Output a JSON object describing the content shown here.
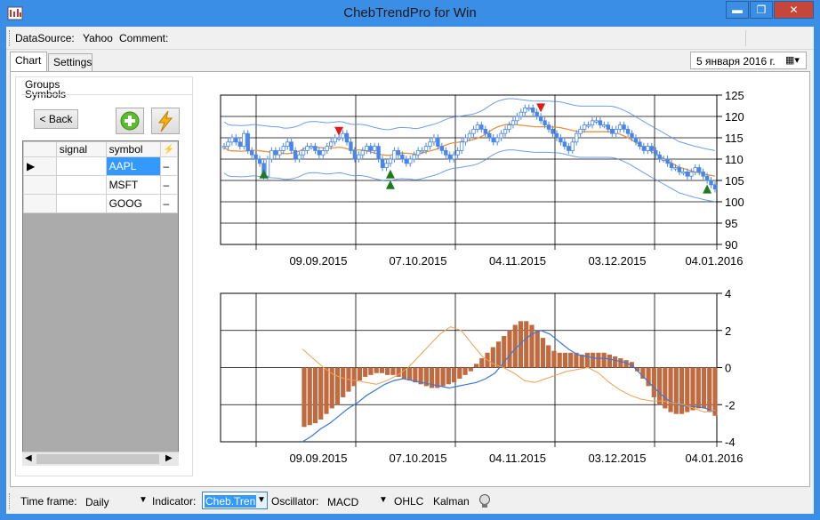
{
  "window": {
    "title": "ChebTrendPro for Win",
    "minimize": "▬",
    "maximize": "❐",
    "close": "✕"
  },
  "topbar": {
    "datasource_label": "DataSource:",
    "datasource_value": "Yahoo",
    "comment_label": "Comment:"
  },
  "tabs": [
    {
      "label": "Chart",
      "active": true
    },
    {
      "label": "Settings",
      "active": false
    }
  ],
  "date_picker": {
    "value": "5   января   2016 г."
  },
  "left": {
    "groups_label": "Groups",
    "symbols_label": "Symbols",
    "back_label": "< Back",
    "columns": [
      "signal",
      "symbol",
      "⚡"
    ],
    "rows": [
      {
        "signal": "",
        "symbol": "AAPL",
        "flag": "–",
        "selected": true
      },
      {
        "signal": "",
        "symbol": "MSFT",
        "flag": "–",
        "selected": false
      },
      {
        "signal": "",
        "symbol": "GOOG",
        "flag": "–",
        "selected": false
      }
    ]
  },
  "bottombar": {
    "timeframe_label": "Time frame:",
    "timeframe_value": "Daily",
    "indicator_label": "Indicator:",
    "indicator_value": "Cheb.Tren",
    "oscillator_label": "Oscillator:",
    "oscillator_value": "MACD",
    "ohlc_label": "OHLC",
    "kalman_label": "Kalman"
  },
  "colors": {
    "candle": "#4a86e8",
    "trend": "#e8923a",
    "channel": "#4a86e8",
    "histogram": "#c06a3f",
    "up_signal": "#1e7a1e",
    "down_signal": "#e21a1a"
  },
  "chart_data": [
    {
      "type": "candlestick",
      "x_tick_labels": [
        "09.09.2015",
        "07.10.2015",
        "04.11.2015",
        "03.12.2015",
        "04.01.2016"
      ],
      "y_tick_labels": [
        "125",
        "120",
        "115",
        "110",
        "105",
        "100",
        "95",
        "90"
      ],
      "ylim": [
        90,
        125
      ],
      "closes": [
        113,
        114,
        115,
        114,
        113,
        116,
        112,
        111,
        110,
        109,
        106,
        110,
        112,
        111,
        112,
        113,
        114,
        112,
        110,
        111,
        112,
        113,
        113,
        112,
        111,
        112,
        113,
        114,
        115,
        115,
        116,
        114,
        112,
        110,
        111,
        112,
        113,
        112,
        113,
        110,
        108,
        109,
        110,
        112,
        111,
        110,
        109,
        110,
        111,
        112,
        112,
        113,
        114,
        115,
        113,
        112,
        111,
        110,
        111,
        112,
        114,
        115,
        116,
        117,
        118,
        117,
        116,
        115,
        114,
        115,
        116,
        117,
        118,
        119,
        120,
        121,
        122,
        122,
        121,
        120,
        119,
        118,
        117,
        116,
        115,
        114,
        113,
        112,
        114,
        116,
        117,
        118,
        118,
        119,
        119,
        118,
        118,
        117,
        116,
        117,
        118,
        117,
        116,
        115,
        114,
        113,
        112,
        113,
        112,
        111,
        110,
        110,
        109,
        108,
        108,
        107,
        107,
        106,
        107,
        108,
        107,
        106,
        105,
        104,
        103
      ],
      "up_signals": [
        {
          "x": 10,
          "y": 106.5
        },
        {
          "x": 42,
          "y": 106.5
        },
        {
          "x": 42,
          "y": 104
        },
        {
          "x": 122,
          "y": 103
        }
      ],
      "down_signals": [
        {
          "x": 29,
          "y": 116.5
        },
        {
          "x": 80,
          "y": 122
        }
      ],
      "grid": true
    },
    {
      "type": "bar",
      "x_tick_labels": [
        "09.09.2015",
        "07.10.2015",
        "04.11.2015",
        "03.12.2015",
        "04.01.2016"
      ],
      "y_tick_labels": [
        "4",
        "2",
        "0",
        "-2",
        "-4"
      ],
      "ylim": [
        -4,
        4
      ],
      "histogram": [
        -3.2,
        -3.1,
        -3.0,
        -2.8,
        -2.5,
        -2.2,
        -2.0,
        -1.6,
        -1.3,
        -1.0,
        -0.7,
        -0.5,
        -0.4,
        -0.3,
        -0.3,
        -0.4,
        -0.4,
        -0.5,
        -0.6,
        -0.7,
        -0.8,
        -0.9,
        -1.0,
        -1.1,
        -1.1,
        -1.0,
        -0.9,
        -0.8,
        -0.6,
        -0.4,
        -0.2,
        0.2,
        0.5,
        0.8,
        1.1,
        1.4,
        1.7,
        2.0,
        2.3,
        2.5,
        2.5,
        2.3,
        2.0,
        1.6,
        1.2,
        0.9,
        0.8,
        0.8,
        0.8,
        0.8,
        0.7,
        0.8,
        0.8,
        0.8,
        0.8,
        0.7,
        0.6,
        0.5,
        0.4,
        0.3,
        -0.2,
        -0.6,
        -1.0,
        -1.6,
        -2.0,
        -2.2,
        -2.4,
        -2.5,
        -2.5,
        -2.4,
        -2.3,
        -2.2,
        -2.2,
        -2.4,
        -2.6
      ],
      "line_blue": [
        -4.0,
        -3.7,
        -3.3,
        -3.0,
        -2.6,
        -2.2,
        -1.9,
        -1.5,
        -1.2,
        -0.9,
        -0.7,
        -0.6,
        -0.7,
        -0.8,
        -0.9,
        -1.0,
        -1.1,
        -1.0,
        -0.9,
        -0.8,
        -0.6,
        -0.3,
        0.3,
        0.9,
        1.4,
        1.8,
        2.0,
        1.8,
        1.4,
        1.0,
        0.7,
        0.6,
        0.5,
        0.5,
        0.4,
        0.3,
        0.1,
        -0.4,
        -0.9,
        -1.4,
        -1.8,
        -2.0,
        -2.1,
        -2.1,
        -2.2,
        -2.4
      ],
      "line_orange": [
        1.0,
        0.5,
        0.0,
        -0.4,
        -0.6,
        -0.7,
        -0.8,
        -0.9,
        -0.7,
        -0.4,
        0.0,
        0.6,
        1.2,
        1.8,
        2.2,
        2.0,
        1.3,
        0.6,
        0.2,
        0.0,
        -0.3,
        -0.7,
        -0.8,
        -0.6,
        -0.4,
        -0.2,
        -0.1,
        0.0,
        -0.3,
        -0.8,
        -1.2,
        -1.5,
        -1.7,
        -1.8,
        -1.8,
        -1.9,
        -2.0,
        -2.2,
        -2.4,
        -2.3
      ],
      "grid": true
    }
  ]
}
